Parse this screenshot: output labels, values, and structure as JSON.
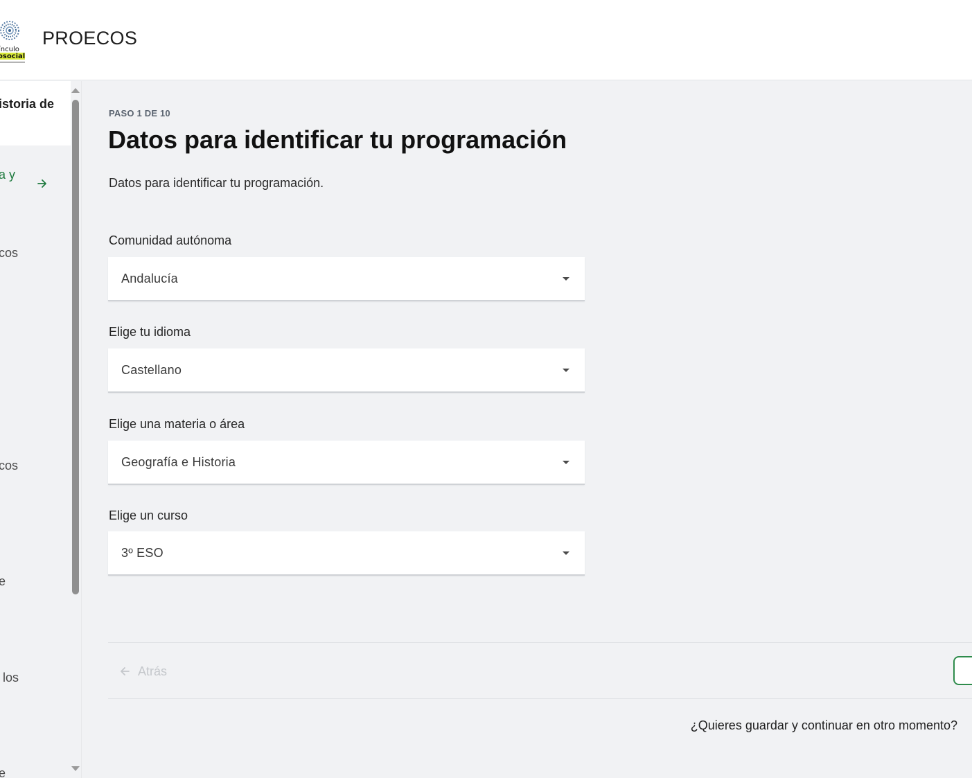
{
  "header": {
    "app_title": "PROECOS",
    "logo": {
      "text_line1": "ínculo",
      "text_line2": "osocial"
    }
  },
  "sidebar": {
    "items": [
      {
        "label": "istoria de"
      },
      {
        "label": "a y"
      },
      {
        "label": "cos"
      },
      {
        "label": "cos"
      },
      {
        "label": "e"
      },
      {
        "label": "los"
      },
      {
        "label": "e"
      }
    ]
  },
  "main": {
    "step": "PASO 1 DE 10",
    "title": "Datos para identificar tu programación",
    "description": "Datos para identificar tu programación.",
    "fields": [
      {
        "label": "Comunidad autónoma",
        "value": "Andalucía"
      },
      {
        "label": "Elige tu idioma",
        "value": "Castellano"
      },
      {
        "label": "Elige una materia o área",
        "value": "Geografía e Historia"
      },
      {
        "label": "Elige un curso",
        "value": "3º ESO"
      }
    ],
    "back_label": "Atrás",
    "save_later": "¿Quieres guardar y continuar en otro momento?"
  },
  "colors": {
    "accent_green": "#2e8b4b",
    "background": "#f1f2f4",
    "disabled_text": "#c4c7cb"
  }
}
